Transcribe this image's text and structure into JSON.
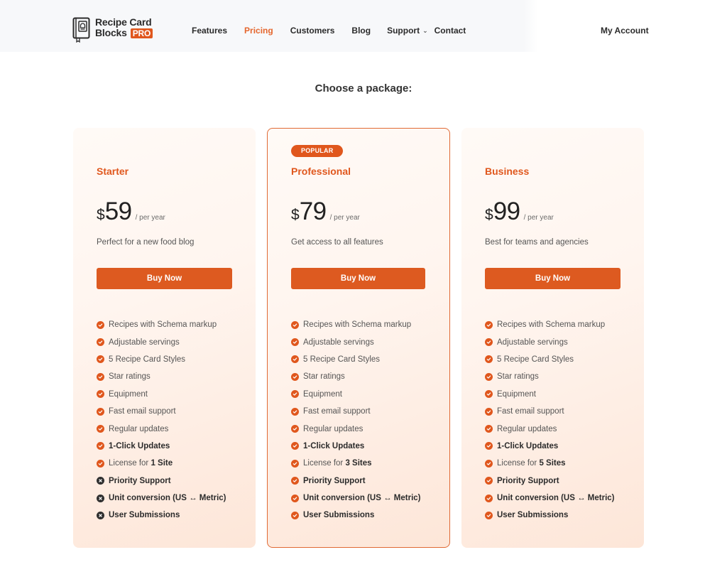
{
  "header": {
    "logo": {
      "line1": "Recipe Card",
      "line2": "Blocks",
      "badge": "PRO"
    },
    "nav": [
      {
        "label": "Features",
        "active": false
      },
      {
        "label": "Pricing",
        "active": true
      },
      {
        "label": "Customers",
        "active": false
      },
      {
        "label": "Blog",
        "active": false
      },
      {
        "label": "Support",
        "active": false,
        "dropdown": true
      },
      {
        "label": "Contact",
        "active": false
      }
    ],
    "account_label": "My Account"
  },
  "page_title": "Choose a package:",
  "colors": {
    "accent": "#e0571d",
    "cross": "#2f2f2f"
  },
  "plans": [
    {
      "name": "Starter",
      "popular": false,
      "currency": "$",
      "price": "59",
      "period": "/ per year",
      "description": "Perfect for a new food blog",
      "button": "Buy Now",
      "features": [
        {
          "text": "Recipes with Schema markup",
          "included": true,
          "bold": false
        },
        {
          "text": "Adjustable servings",
          "included": true,
          "bold": false
        },
        {
          "text": "5 Recipe Card Styles",
          "included": true,
          "bold": false
        },
        {
          "text": "Star ratings",
          "included": true,
          "bold": false
        },
        {
          "text": "Equipment",
          "included": true,
          "bold": false
        },
        {
          "text": "Fast email support",
          "included": true,
          "bold": false
        },
        {
          "text": "Regular updates",
          "included": true,
          "bold": false
        },
        {
          "text": "1-Click Updates",
          "included": true,
          "bold": true
        },
        {
          "text": "License for ",
          "strong": "1 Site",
          "included": true,
          "bold": false
        },
        {
          "text": "Priority Support",
          "included": false,
          "bold": true
        },
        {
          "text": "Unit conversion (US ↔ Metric)",
          "included": false,
          "bold": true
        },
        {
          "text": "User Submissions",
          "included": false,
          "bold": true
        }
      ]
    },
    {
      "name": "Professional",
      "popular": true,
      "badge": "POPULAR",
      "currency": "$",
      "price": "79",
      "period": "/ per year",
      "description": "Get access to all features",
      "button": "Buy Now",
      "features": [
        {
          "text": "Recipes with Schema markup",
          "included": true,
          "bold": false
        },
        {
          "text": "Adjustable servings",
          "included": true,
          "bold": false
        },
        {
          "text": "5 Recipe Card Styles",
          "included": true,
          "bold": false
        },
        {
          "text": "Star ratings",
          "included": true,
          "bold": false
        },
        {
          "text": "Equipment",
          "included": true,
          "bold": false
        },
        {
          "text": "Fast email support",
          "included": true,
          "bold": false
        },
        {
          "text": "Regular updates",
          "included": true,
          "bold": false
        },
        {
          "text": "1-Click Updates",
          "included": true,
          "bold": true
        },
        {
          "text": "License for ",
          "strong": "3 Sites",
          "included": true,
          "bold": false
        },
        {
          "text": "Priority Support",
          "included": true,
          "bold": true
        },
        {
          "text": "Unit conversion (US ↔ Metric)",
          "included": true,
          "bold": true
        },
        {
          "text": "User Submissions",
          "included": true,
          "bold": true
        }
      ]
    },
    {
      "name": "Business",
      "popular": false,
      "currency": "$",
      "price": "99",
      "period": "/ per year",
      "description": "Best for teams and agencies",
      "button": "Buy Now",
      "features": [
        {
          "text": "Recipes with Schema markup",
          "included": true,
          "bold": false
        },
        {
          "text": "Adjustable servings",
          "included": true,
          "bold": false
        },
        {
          "text": "5 Recipe Card Styles",
          "included": true,
          "bold": false
        },
        {
          "text": "Star ratings",
          "included": true,
          "bold": false
        },
        {
          "text": "Equipment",
          "included": true,
          "bold": false
        },
        {
          "text": "Fast email support",
          "included": true,
          "bold": false
        },
        {
          "text": "Regular updates",
          "included": true,
          "bold": false
        },
        {
          "text": "1-Click Updates",
          "included": true,
          "bold": true
        },
        {
          "text": "License for ",
          "strong": "5 Sites",
          "included": true,
          "bold": false
        },
        {
          "text": "Priority Support",
          "included": true,
          "bold": true
        },
        {
          "text": "Unit conversion (US ↔ Metric)",
          "included": true,
          "bold": true
        },
        {
          "text": "User Submissions",
          "included": true,
          "bold": true
        }
      ]
    }
  ]
}
